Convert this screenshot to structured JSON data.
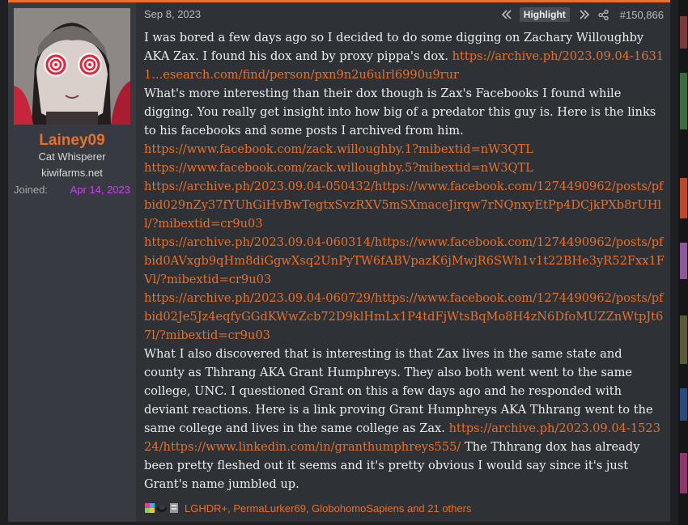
{
  "user": {
    "name": "Lainey09",
    "title": "Cat Whisperer",
    "site": "kiwifarms.net",
    "joined_label": "Joined:",
    "joined_date": "Apr 14, 2023"
  },
  "post": {
    "date": "Sep 8, 2023",
    "highlight_label": "Highlight",
    "number": "#150,866",
    "p1_text": "I was bored a few days ago so I decided to do some digging on Zachary Willoughby AKA Zax. I found his dox and by proxy pippa's dox. ",
    "p1_link": "https://archive.ph/2023.09.04-16311...esearch.com/find/person/pxn9n2u6ulrl6990u9rur",
    "p2_text": "What's more interesting than their dox though is Zax's Facebooks I found while digging. You really get insight into how big of a predator this guy is. Here is the links to his facebooks and some posts I archived from him.",
    "links": [
      "https://www.facebook.com/zack.willoughby.1?mibextid=nW3QTL",
      "https://www.facebook.com/zack.willoughby.5?mibextid=nW3QTL",
      "https://archive.ph/2023.09.04-050432/https://www.facebook.com/1274490962/posts/pfbid029nZy37fYUhGiHvBwTegtxSvzRXV5mSXmaceJirqw7rNQnxyEtPp4DCjkPXb8rUHll/?mibextid=cr9u03",
      "https://archive.ph/2023.09.04-060314/https://www.facebook.com/1274490962/posts/pfbid0AVxgb9qHm8diGgwXsq2UnPyTW6fABVpazK6jMwjR6SWh1v1t22BHe3yR52Fxx1FVl/?mibextid=cr9u03",
      "https://archive.ph/2023.09.04-060729/https://www.facebook.com/1274490962/posts/pfbid02Je5Jz4eqfyGGdKWwZcb72D9klHmLx1P4tdFjWtsBqMo8H4zN6DfoMUZZnWtpJt67l/?mibextid=cr9u03"
    ],
    "p3_text": "What I also discovered that is interesting is that Zax lives in the same state and county as Thhrang AKA Grant Humphreys. They also both went went to the same college, UNC. I questioned Grant on this a few days ago and he responded with deviant reactions. Here is a link proving Grant Humphreys AKA Thhrang went to the same college and lives in the same college as Zax. ",
    "p3_link": "https://archive.ph/2023.09.04-152324/https://www.linkedin.com/in/granthumphreys555/",
    "p3_tail": " The Thhrang dox has already been pretty fleshed out it seems and it's pretty obvious I would say since it's just Grant's name jumbled up."
  },
  "reactions": {
    "text": "LGHDR+, PermaLurker69, GlobohomoSapiens and 21 others"
  },
  "colors": {
    "accent": "#e8702b",
    "joined_date": "#c845e8",
    "post_bg": "#2e3136",
    "user_bg": "#373b41"
  },
  "icons": {
    "prev": "double-chevron-left-icon",
    "next": "double-chevron-right-icon",
    "share": "share-icon"
  }
}
